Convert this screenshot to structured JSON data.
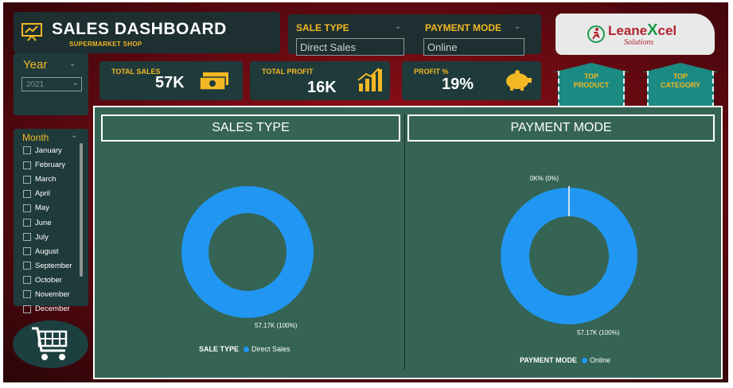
{
  "header": {
    "title": "SALES DASHBOARD",
    "subtitle": "SUPERMARKET SHOP"
  },
  "filters": {
    "sale_type": {
      "label": "SALE TYPE",
      "value": "Direct Sales"
    },
    "payment_mode": {
      "label": "PAYMENT MODE",
      "value": "Online"
    }
  },
  "logo": {
    "name_part1": "Leane",
    "name_x": "X",
    "name_part2": "cel",
    "tagline": "Solutions"
  },
  "year_filter": {
    "label": "Year",
    "value": "2021"
  },
  "kpis": [
    {
      "label": "TOTAL SALES",
      "value": "57K",
      "icon": "money-icon"
    },
    {
      "label": "TOTAL PROFIT",
      "value": "16K",
      "icon": "bar-chart-icon"
    },
    {
      "label": "PROFIT %",
      "value": "19%",
      "icon": "piggy-bank-icon"
    }
  ],
  "top_buttons": {
    "product": {
      "line1": "TOP",
      "line2": "PRODUCT"
    },
    "category": {
      "line1": "TOP",
      "line2": "CATEGORY"
    }
  },
  "month_filter": {
    "label": "Month",
    "months": [
      "January",
      "February",
      "March",
      "April",
      "May",
      "June",
      "July",
      "August",
      "September",
      "October",
      "November",
      "December"
    ]
  },
  "sales_type_chart": {
    "title": "SALES TYPE",
    "slice_label": "57.17K (100%)",
    "legend_title": "SALE TYPE",
    "legend_item": "Direct Sales"
  },
  "payment_mode_chart": {
    "title": "PAYMENT MODE",
    "zero_label": "0K% (0%)",
    "slice_label": "57.17K (100%)",
    "legend_title": "PAYMENT MODE",
    "legend_item": "Online"
  },
  "chart_data": [
    {
      "type": "pie",
      "title": "SALES TYPE",
      "categories": [
        "Direct Sales"
      ],
      "values": [
        57.17
      ],
      "unit": "K",
      "legend": "bottom"
    },
    {
      "type": "pie",
      "title": "PAYMENT MODE",
      "categories": [
        "Online"
      ],
      "values": [
        57.17
      ],
      "unit": "K",
      "legend": "bottom"
    }
  ],
  "colors": {
    "accent": "#f2b824",
    "donut": "#2196f3",
    "panel": "#356454",
    "button": "#1b8a83"
  }
}
